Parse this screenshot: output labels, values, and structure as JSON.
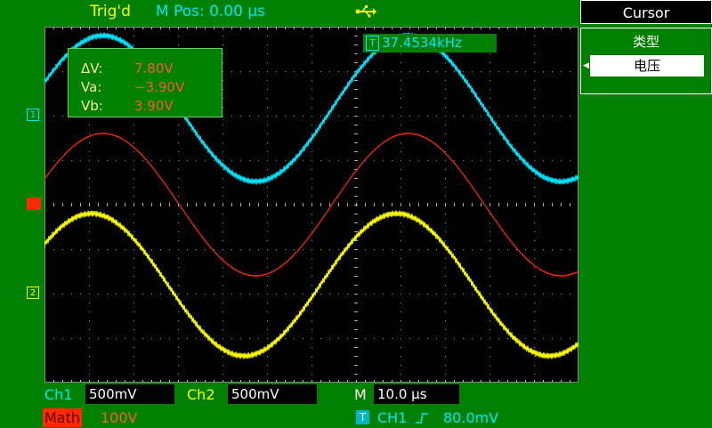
{
  "header": {
    "trigger_status": "Trig'd",
    "main_position": "M Pos: 0.00 µs",
    "usb_icon": "usb-icon"
  },
  "screen": {
    "cursor_readout": {
      "delta_label": "ΔV:",
      "delta_value": "7.80V",
      "a_label": "Va:",
      "a_value": "−3.90V",
      "b_label": "Vb:",
      "b_value": "3.90V"
    },
    "frequency": {
      "trigger_marker": "T",
      "value": "37.4534kHz"
    },
    "markers": {
      "ch1": "1",
      "ch2": "2",
      "math": "M"
    },
    "colors": {
      "ch1": "#00e5ff",
      "ch2": "#ffff00",
      "math": "#ff2a00",
      "background": "#008000",
      "screen": "#000000"
    }
  },
  "menu": {
    "title": "Cursor",
    "type_label": "类型",
    "type_value": "电压"
  },
  "status": {
    "ch1_label": "Ch1",
    "ch1_scale": "500mV",
    "ch2_label": "Ch2",
    "ch2_scale": "500mV",
    "timebase_label": "M",
    "timebase": "10.0 µs",
    "math_label": "Math",
    "math_scale": "100V",
    "trigger_marker": "T",
    "trigger_source": "CH1",
    "trigger_level": "80.0mV"
  }
}
